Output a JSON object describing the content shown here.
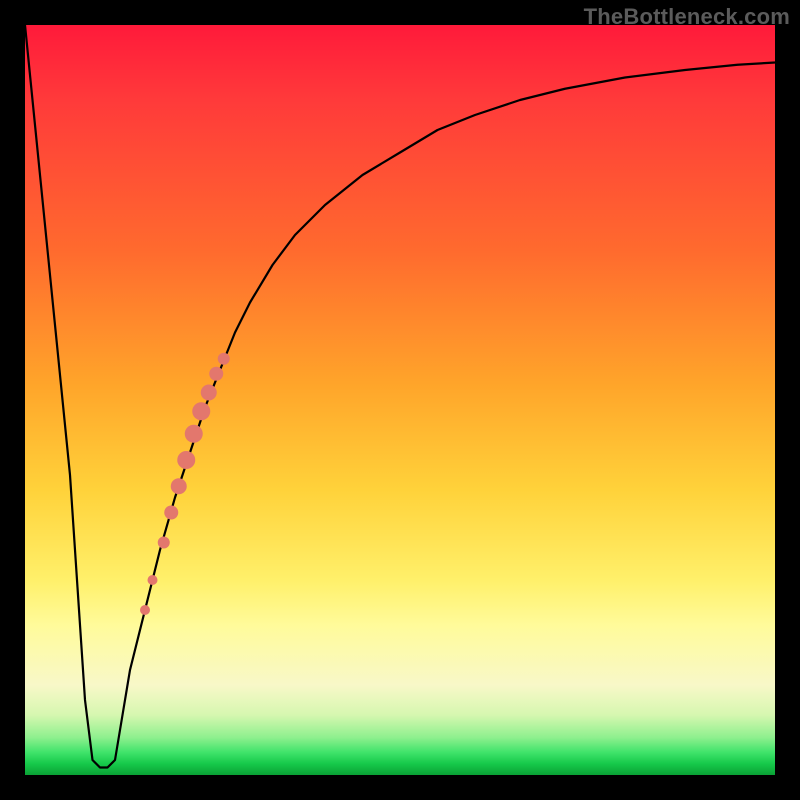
{
  "watermark": "TheBottleneck.com",
  "chart_data": {
    "type": "line",
    "title": "",
    "xlabel": "",
    "ylabel": "",
    "xlim": [
      0,
      100
    ],
    "ylim": [
      0,
      100
    ],
    "grid": false,
    "legend": false,
    "background": "rainbow-gradient (red top → green bottom)",
    "frame_color": "#000000",
    "series": [
      {
        "name": "bottleneck-curve",
        "color": "#000000",
        "x": [
          0,
          2,
          4,
          6,
          7,
          8,
          9,
          10,
          11,
          12,
          13,
          14,
          16,
          18,
          20,
          22,
          24,
          26,
          28,
          30,
          33,
          36,
          40,
          45,
          50,
          55,
          60,
          66,
          72,
          80,
          88,
          95,
          100
        ],
        "y": [
          100,
          80,
          60,
          40,
          25,
          10,
          2,
          1,
          1,
          2,
          8,
          14,
          22,
          30,
          37,
          43,
          49,
          54,
          59,
          63,
          68,
          72,
          76,
          80,
          83,
          86,
          88,
          90,
          91.5,
          93,
          94,
          94.7,
          95
        ]
      }
    ],
    "markers": {
      "name": "highlighted-segment",
      "color": "#e3776d",
      "points": [
        {
          "x": 16.0,
          "y": 22.0,
          "r": 5
        },
        {
          "x": 17.0,
          "y": 26.0,
          "r": 5
        },
        {
          "x": 18.5,
          "y": 31.0,
          "r": 6
        },
        {
          "x": 19.5,
          "y": 35.0,
          "r": 7
        },
        {
          "x": 20.5,
          "y": 38.5,
          "r": 8
        },
        {
          "x": 21.5,
          "y": 42.0,
          "r": 9
        },
        {
          "x": 22.5,
          "y": 45.5,
          "r": 9
        },
        {
          "x": 23.5,
          "y": 48.5,
          "r": 9
        },
        {
          "x": 24.5,
          "y": 51.0,
          "r": 8
        },
        {
          "x": 25.5,
          "y": 53.5,
          "r": 7
        },
        {
          "x": 26.5,
          "y": 55.5,
          "r": 6
        }
      ]
    },
    "notch": {
      "x_start": 9,
      "x_end": 11,
      "y": 1
    }
  }
}
